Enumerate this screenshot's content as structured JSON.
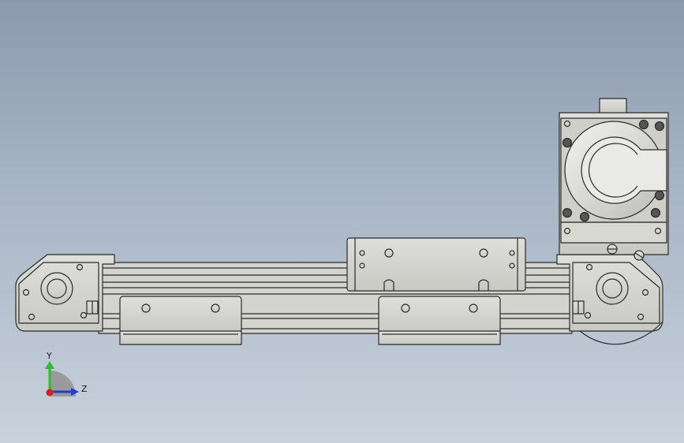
{
  "viewport": {
    "background_top": "#8c9aae",
    "background_bottom": "#c9d2dc",
    "part_fill": "#d6d6d2",
    "part_edge": "#2a2a2a"
  },
  "model": {
    "description_icon": "linear-actuator-assembly"
  },
  "triad": {
    "y_label": "Y",
    "z_label": "Z",
    "y_color": "#2bbf2b",
    "z_color": "#1f3ed6",
    "x_color": "#d81e1e"
  }
}
